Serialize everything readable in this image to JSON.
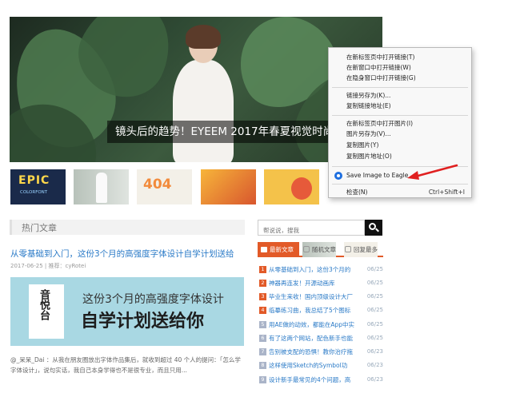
{
  "hero": {
    "caption": "镜头后的趋势！EYEEM 2017年春夏视觉时尚趋",
    "prev_arrow": "←"
  },
  "thumbnails": {
    "epic_title": "EPIC",
    "epic_sub": "COLORFONT",
    "num_404": "404"
  },
  "context_menu": {
    "items": [
      "在新标签页中打开链接(T)",
      "在新窗口中打开链接(W)",
      "在隐身窗口中打开链接(G)",
      "链接另存为(K)...",
      "复制链接地址(E)",
      "在新标签页中打开图片(I)",
      "图片另存为(V)...",
      "复制图片(Y)",
      "复制图片地址(O)",
      "Save Image to Eagle",
      "检查(N)"
    ],
    "inspect_shortcut": "Ctrl+Shift+I"
  },
  "hot": {
    "heading": "热门文章",
    "article_title": "从零基础到入门，这份3个月的高强度字体设计自学计划送给",
    "article_meta": "2017-06-25 | 推荐：cyRotei",
    "image_card_text": "音悦台",
    "image_line1": "这份3个月的高强度字体设计",
    "image_line2": "自学计划送给你",
    "excerpt": "@_呆呆_Dai ：从我在朋友圈放出字体作品集后，就收到超过 40 个人的提问：「怎么学字体设计」，说句实话，我自己本身学得也不是很专业，而且只用..."
  },
  "sidebar": {
    "search_placeholder": "帮说说，搜我",
    "tabs": [
      "最新文章",
      "随机文章",
      "回复最多"
    ],
    "list": [
      {
        "n": "1",
        "text": "从零基础到入门，这份3个月的",
        "date": "06/25"
      },
      {
        "n": "2",
        "text": "神器再连发！开源动画库",
        "date": "06/25"
      },
      {
        "n": "3",
        "text": "毕业生来收！国内顶级设计大厂",
        "date": "06/25"
      },
      {
        "n": "4",
        "text": "临摹练习曲，我总结了5个图标",
        "date": "06/25"
      },
      {
        "n": "5",
        "text": "用AE做的动效，都能在App中实",
        "date": "06/25"
      },
      {
        "n": "6",
        "text": "有了这两个网站，配色新手也能",
        "date": "06/25"
      },
      {
        "n": "7",
        "text": "告别被支配的恐惧！教你治疗拖",
        "date": "06/23"
      },
      {
        "n": "8",
        "text": "这样使用Sketch的Symbol功",
        "date": "06/23"
      },
      {
        "n": "9",
        "text": "设计新手最常见的4个问题，高",
        "date": "06/23"
      }
    ]
  }
}
